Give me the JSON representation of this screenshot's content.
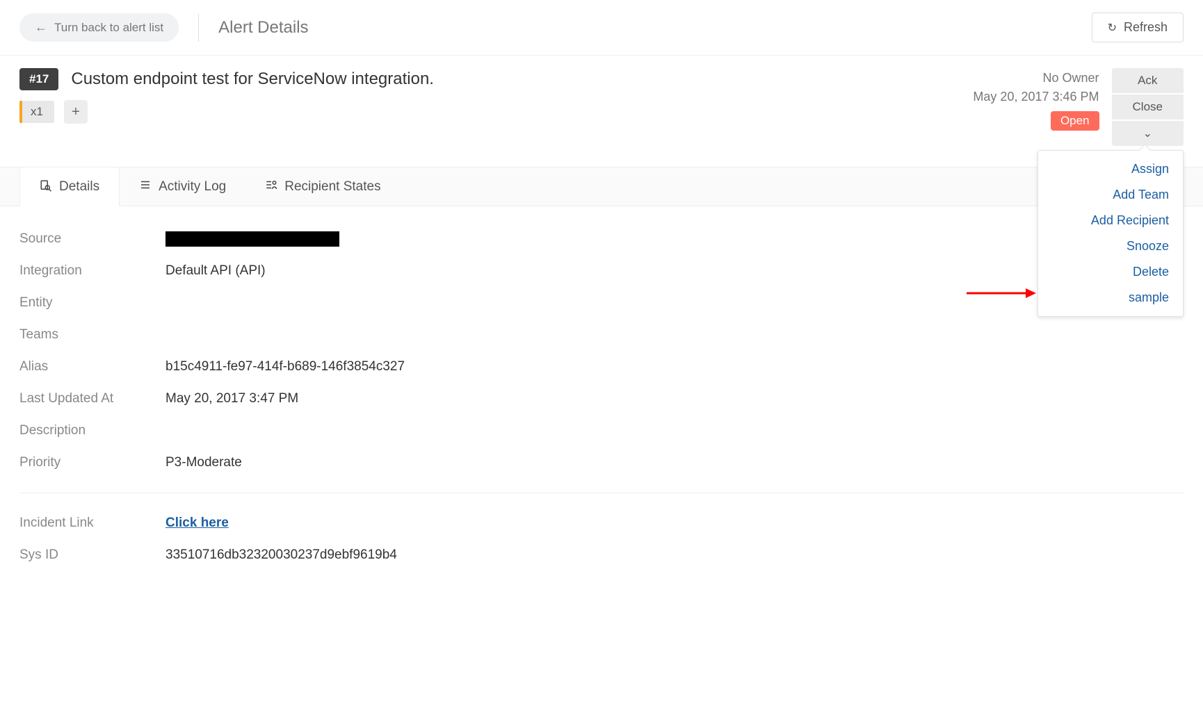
{
  "header": {
    "back_label": "Turn back to alert list",
    "page_title": "Alert Details",
    "refresh_label": "Refresh"
  },
  "alert": {
    "id_badge": "#17",
    "title": "Custom endpoint test for ServiceNow integration.",
    "count_tag": "x1",
    "owner": "No Owner",
    "created_at": "May 20, 2017 3:46 PM",
    "status": "Open"
  },
  "actions": {
    "ack": "Ack",
    "close": "Close"
  },
  "dropdown": {
    "assign": "Assign",
    "add_team": "Add Team",
    "add_recipient": "Add Recipient",
    "snooze": "Snooze",
    "delete": "Delete",
    "sample": "sample"
  },
  "tabs": {
    "details": "Details",
    "activity_log": "Activity Log",
    "recipient_states": "Recipient States"
  },
  "details": {
    "labels": {
      "source": "Source",
      "integration": "Integration",
      "entity": "Entity",
      "teams": "Teams",
      "alias": "Alias",
      "last_updated_at": "Last Updated At",
      "description": "Description",
      "priority": "Priority",
      "incident_link": "Incident Link",
      "sys_id": "Sys ID"
    },
    "values": {
      "integration": "Default API (API)",
      "entity": "",
      "teams": "",
      "alias": "b15c4911-fe97-414f-b689-146f3854c327",
      "last_updated_at": "May 20, 2017 3:47 PM",
      "description": "",
      "priority": "P3-Moderate",
      "incident_link": "Click here",
      "sys_id": "33510716db32320030237d9ebf9619b4"
    }
  }
}
